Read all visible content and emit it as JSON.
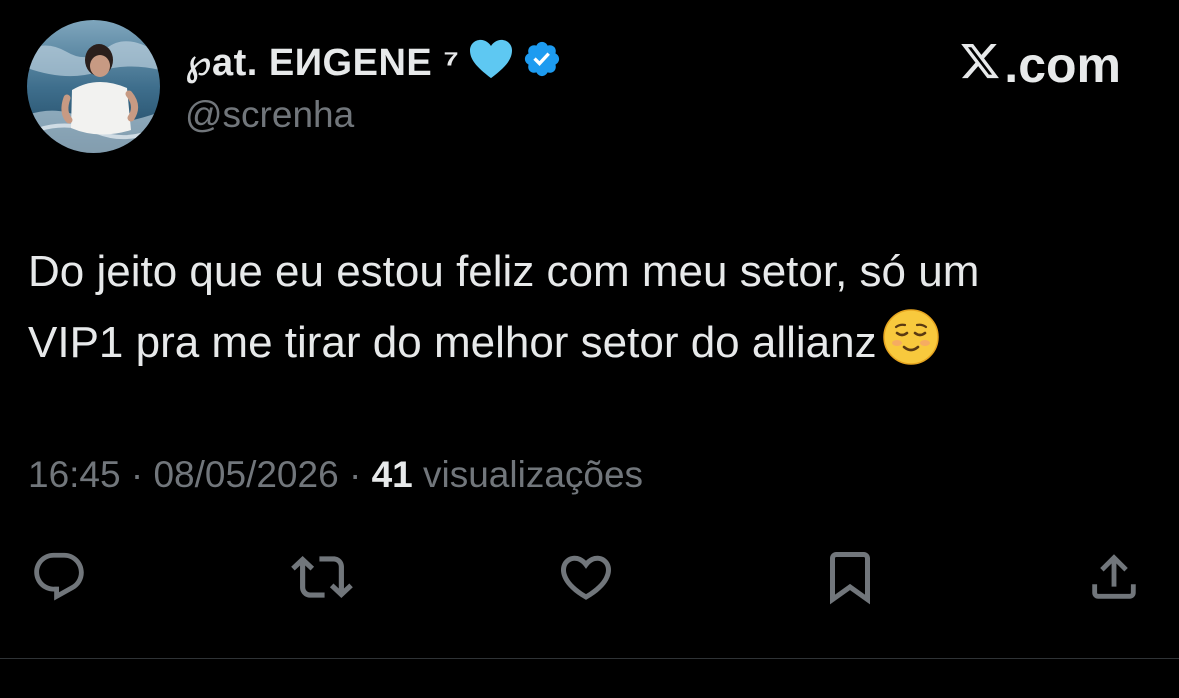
{
  "author": {
    "display_name": "℘at. EИGENE ⁷",
    "handle": "@screnha",
    "verified": true,
    "name_emoji": "light-blue-heart-icon"
  },
  "brand": {
    "text": ".com",
    "logo": "x-logo-icon"
  },
  "tweet": {
    "line1": "Do jeito que eu estou feliz com meu setor, só um",
    "line2": "VIP1 pra me tirar do melhor setor do allianz",
    "emoji": "relieved-face-emoji"
  },
  "meta": {
    "time": "16:45",
    "separator1": " · ",
    "date": "08/05/2026",
    "separator2": " · ",
    "views_count": "41",
    "views_label": " visualizações"
  },
  "actions": [
    "reply-icon",
    "retweet-icon",
    "like-icon",
    "bookmark-icon",
    "share-icon"
  ],
  "colors": {
    "background": "#000000",
    "text": "#e7e9ea",
    "secondary": "#71767b",
    "verified": "#1d9bf0",
    "heart": "#5ec8f2"
  }
}
